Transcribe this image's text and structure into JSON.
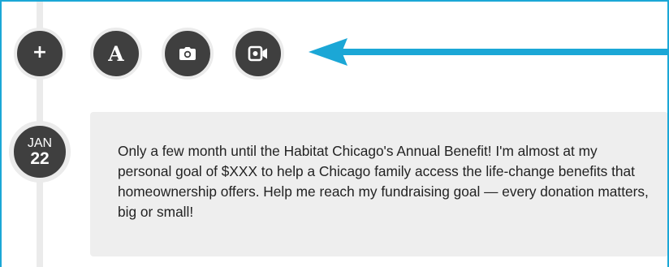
{
  "toolbar": {
    "add": {
      "label": "+",
      "icon": "plus-icon"
    },
    "text": {
      "label": "A",
      "icon": "text-a-icon"
    },
    "photo": {
      "icon": "camera-icon"
    },
    "video": {
      "icon": "video-camera-icon"
    }
  },
  "arrow": {
    "icon": "arrow-left-icon",
    "color": "#1ba7d6"
  },
  "post": {
    "date": {
      "month": "JAN",
      "day": "22"
    },
    "text": "Only a few month until the Habitat Chicago's Annual Benefit! I'm almost at my personal goal of $XXX to help a Chicago family access the life-change benefits that homeownership offers. Help me reach my fundraising goal — every donation matters, big or small!"
  },
  "colors": {
    "frame": "#1ba7d6",
    "button": "#3f3f3f",
    "timeline": "#ebebeb",
    "card": "#eeeeee",
    "text": "#222222"
  }
}
